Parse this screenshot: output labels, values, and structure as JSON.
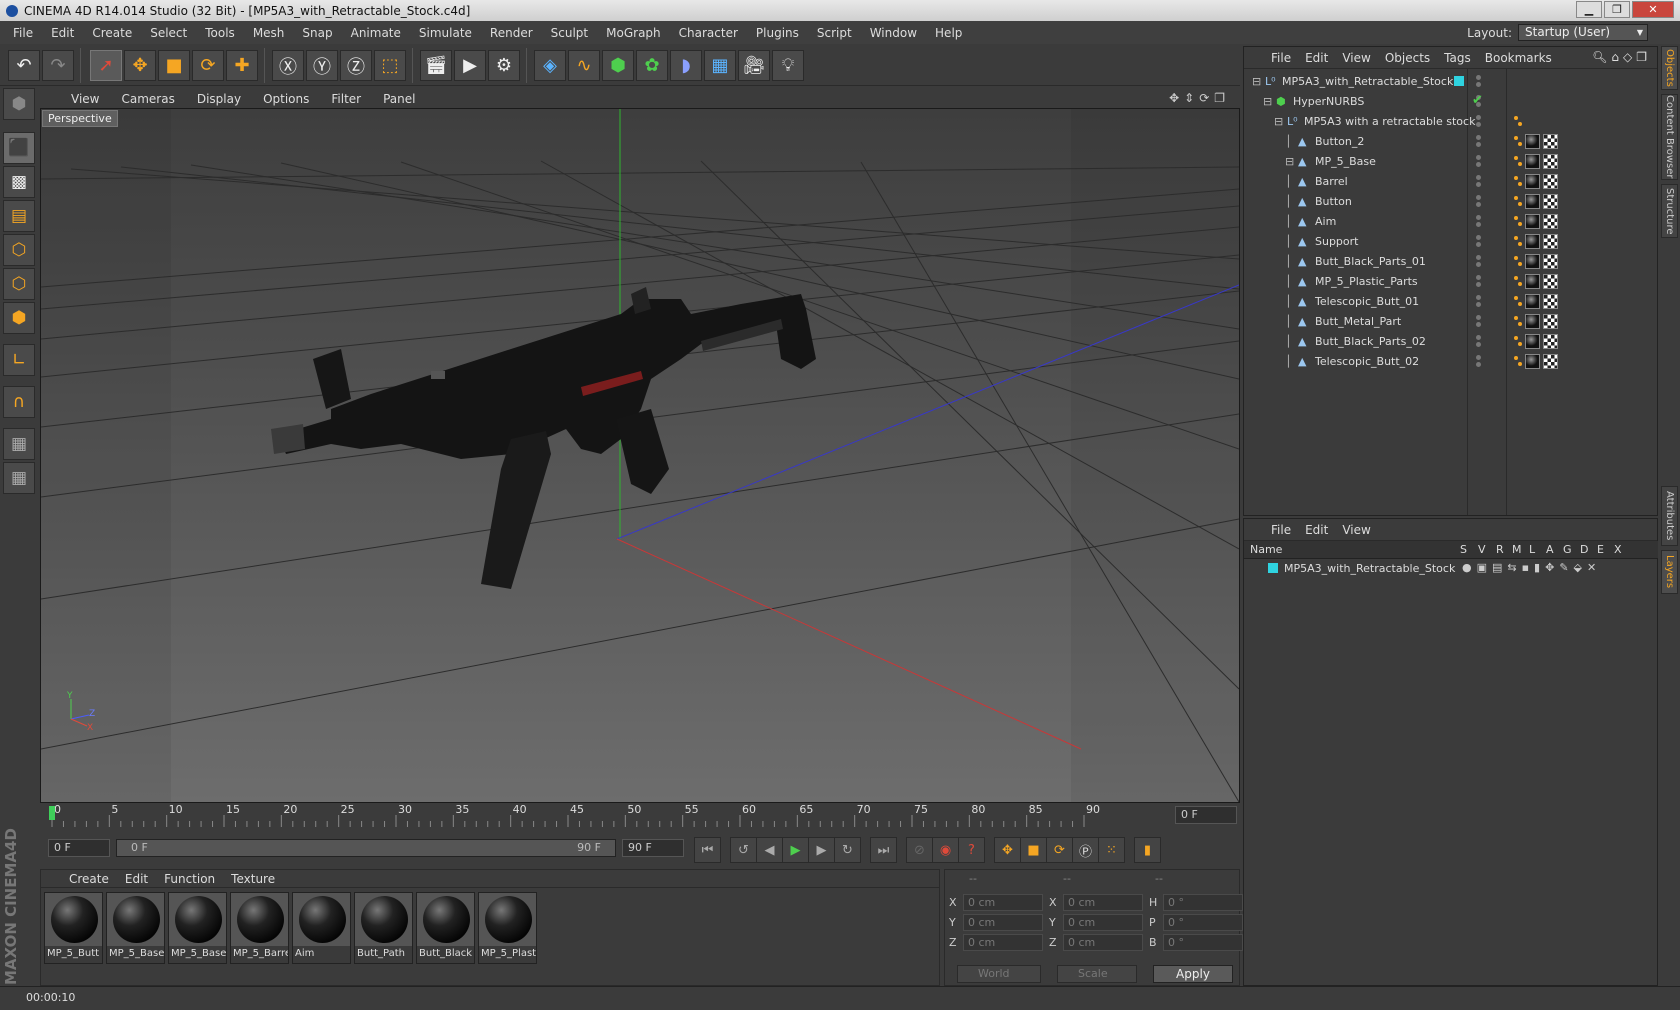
{
  "window": {
    "title": "CINEMA 4D R14.014 Studio (32 Bit) - [MP5A3_with_Retractable_Stock.c4d]",
    "min": "▁",
    "max": "❐",
    "close": "✕"
  },
  "menu": [
    "File",
    "Edit",
    "Create",
    "Select",
    "Tools",
    "Mesh",
    "Snap",
    "Animate",
    "Simulate",
    "Render",
    "Sculpt",
    "MoGraph",
    "Character",
    "Plugins",
    "Script",
    "Window",
    "Help"
  ],
  "layout": {
    "label": "Layout:",
    "value": "Startup (User)"
  },
  "viewport": {
    "menu": [
      "View",
      "Cameras",
      "Display",
      "Options",
      "Filter",
      "Panel"
    ],
    "label": "Perspective",
    "axis_x": "X",
    "axis_y": "Y",
    "axis_z": "Z"
  },
  "timeline": {
    "ticks": [
      "0",
      "5",
      "10",
      "15",
      "20",
      "25",
      "30",
      "35",
      "40",
      "45",
      "50",
      "55",
      "60",
      "65",
      "70",
      "75",
      "80",
      "85",
      "90"
    ],
    "current": "0 F"
  },
  "transport": {
    "start": "0 F",
    "range_start": "0 F",
    "range_end": "90 F",
    "end": "90 F"
  },
  "materials": {
    "menu": [
      "Create",
      "Edit",
      "Function",
      "Texture"
    ],
    "items": [
      "MP_5_Butt",
      "MP_5_Base",
      "MP_5_Base",
      "MP_5_Barre",
      "Aim",
      "Butt_Path",
      "Butt_Black",
      "MP_5_Plast"
    ]
  },
  "coords": {
    "headers": [
      "--",
      "--",
      "--"
    ],
    "rows": [
      {
        "a": "X",
        "av": "0 cm",
        "b": "X",
        "bv": "0 cm",
        "c": "H",
        "cv": "0 °"
      },
      {
        "a": "Y",
        "av": "0 cm",
        "b": "Y",
        "bv": "0 cm",
        "c": "P",
        "cv": "0 °"
      },
      {
        "a": "Z",
        "av": "0 cm",
        "b": "Z",
        "bv": "0 cm",
        "c": "B",
        "cv": "0 °"
      }
    ],
    "space": "World",
    "mode": "Scale",
    "apply": "Apply"
  },
  "status": "00:00:10",
  "objects": {
    "menu": [
      "File",
      "Edit",
      "View",
      "Objects",
      "Tags",
      "Bookmarks"
    ],
    "items": [
      {
        "name": "MP5A3_with_Retractable_Stock",
        "level": 0
      },
      {
        "name": "HyperNURBS",
        "level": 1
      },
      {
        "name": "MP5A3 with a retractable stock",
        "level": 2
      },
      {
        "name": "Button_2",
        "level": 3
      },
      {
        "name": "MP_5_Base",
        "level": 3
      },
      {
        "name": "Barrel",
        "level": 3
      },
      {
        "name": "Button",
        "level": 3
      },
      {
        "name": "Aim",
        "level": 3
      },
      {
        "name": "Support",
        "level": 3
      },
      {
        "name": "Butt_Black_Parts_01",
        "level": 3
      },
      {
        "name": "MP_5_Plastic_Parts",
        "level": 3
      },
      {
        "name": "Telescopic_Butt_01",
        "level": 3
      },
      {
        "name": "Butt_Metal_Part",
        "level": 3
      },
      {
        "name": "Butt_Black_Parts_02",
        "level": 3
      },
      {
        "name": "Telescopic_Butt_02",
        "level": 3
      }
    ]
  },
  "layers": {
    "menu": [
      "File",
      "Edit",
      "View"
    ],
    "name_header": "Name",
    "cols": [
      "S",
      "V",
      "R",
      "M",
      "L",
      "A",
      "G",
      "D",
      "E",
      "X"
    ],
    "row": "MP5A3_with_Retractable_Stock"
  },
  "side_tabs": [
    "Objects",
    "Content Browser",
    "Structure",
    "Attributes",
    "Layers"
  ],
  "colors": {
    "accent": "#f5a623",
    "layer": "#2fd3e0",
    "ui_bg": "#3b3b3b"
  }
}
